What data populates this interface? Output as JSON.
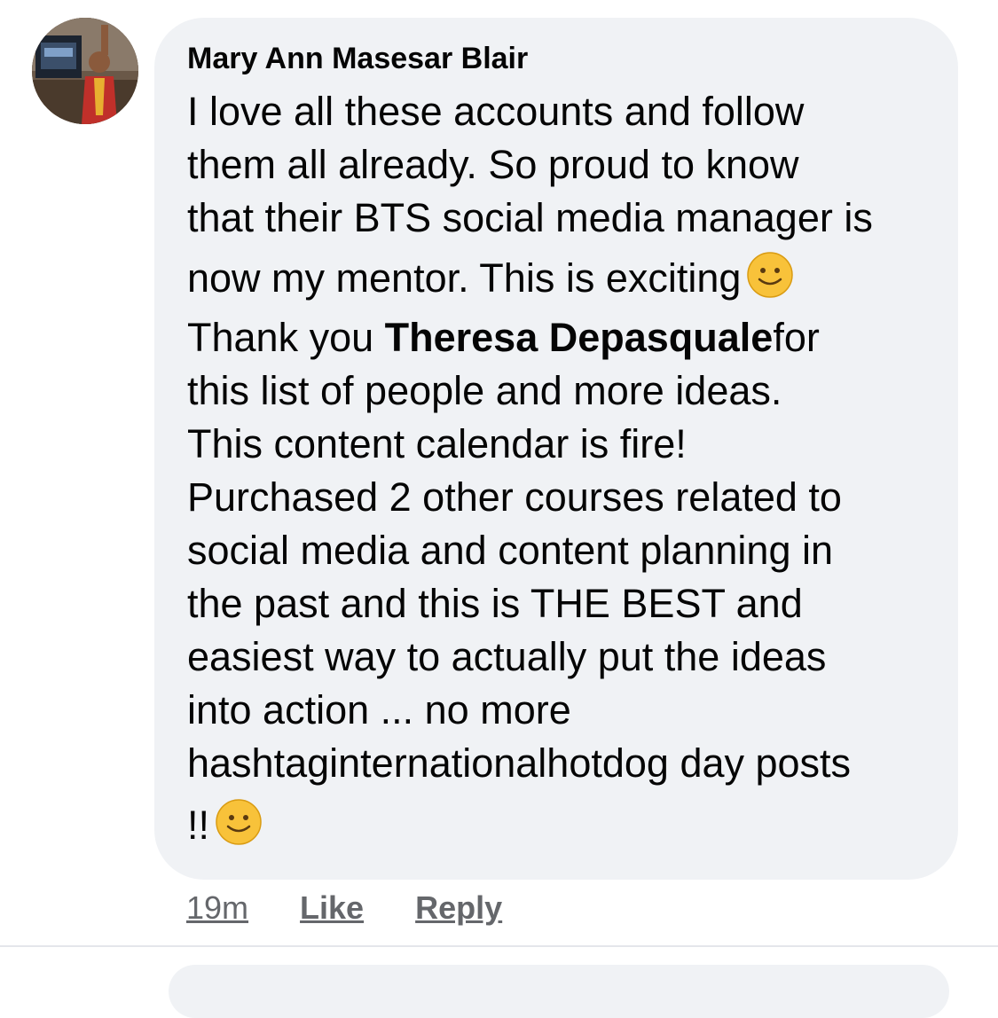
{
  "comment": {
    "author": "Mary Ann Masesar Blair",
    "lines": {
      "l1": "I love all these accounts and follow",
      "l2": "them all already.  So proud to know",
      "l3": "that their BTS social media manager is",
      "l4": "now my mentor.  This is exciting",
      "l5_pre": "Thank you ",
      "l5_mention": "Theresa Depasquale",
      "l5_post": "for",
      "l6": "this list of people and more ideas.",
      "l7": "This content calendar is fire!",
      "l8": "Purchased 2 other courses related to",
      "l9": "social media and content planning in",
      "l10": "the past and this is THE BEST and",
      "l11": "easiest way to actually put the ideas",
      "l12": "into action ... no more",
      "l13": "hashtaginternationalhotdog day posts",
      "l14": "!!"
    },
    "emoji": "slightly-smiling-face",
    "timestamp": "19m",
    "like_label": "Like",
    "reply_label": "Reply"
  },
  "colors": {
    "bubble": "#f0f2f5",
    "text": "#050505",
    "meta": "#65676b",
    "emoji": "#f8c23a"
  }
}
